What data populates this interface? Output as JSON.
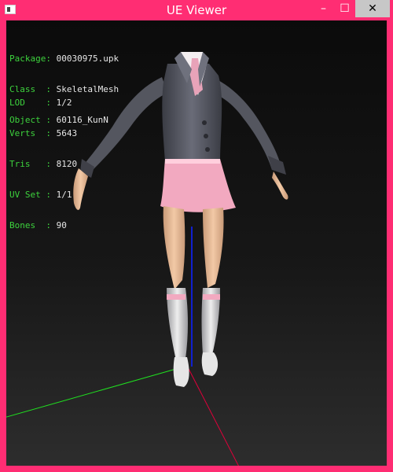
{
  "window": {
    "title": "UE Viewer",
    "controls": {
      "minimize": "–",
      "maximize": "☐",
      "close": "✕"
    }
  },
  "info": {
    "package_label": "Package:",
    "package_value": "00030975.upk",
    "class_label": "Class  :",
    "class_value": "SkeletalMesh",
    "object_label": "Object :",
    "object_value": "60116_KunN",
    "lod_label": "LOD    :",
    "lod_value": "1/2",
    "verts_label": "Verts  :",
    "verts_value": "5643",
    "tris_label": "Tris   :",
    "tris_value": "8120",
    "uvset_label": "UV Set :",
    "uvset_value": "1/1",
    "bones_label": "Bones  :",
    "bones_value": "90"
  },
  "colors": {
    "window_frame": "#ff2d73",
    "info_label": "#3dd23d",
    "info_value": "#e6e6e6",
    "axis_x": "#e0003a",
    "axis_y": "#20e020",
    "axis_z": "#1020d0"
  }
}
